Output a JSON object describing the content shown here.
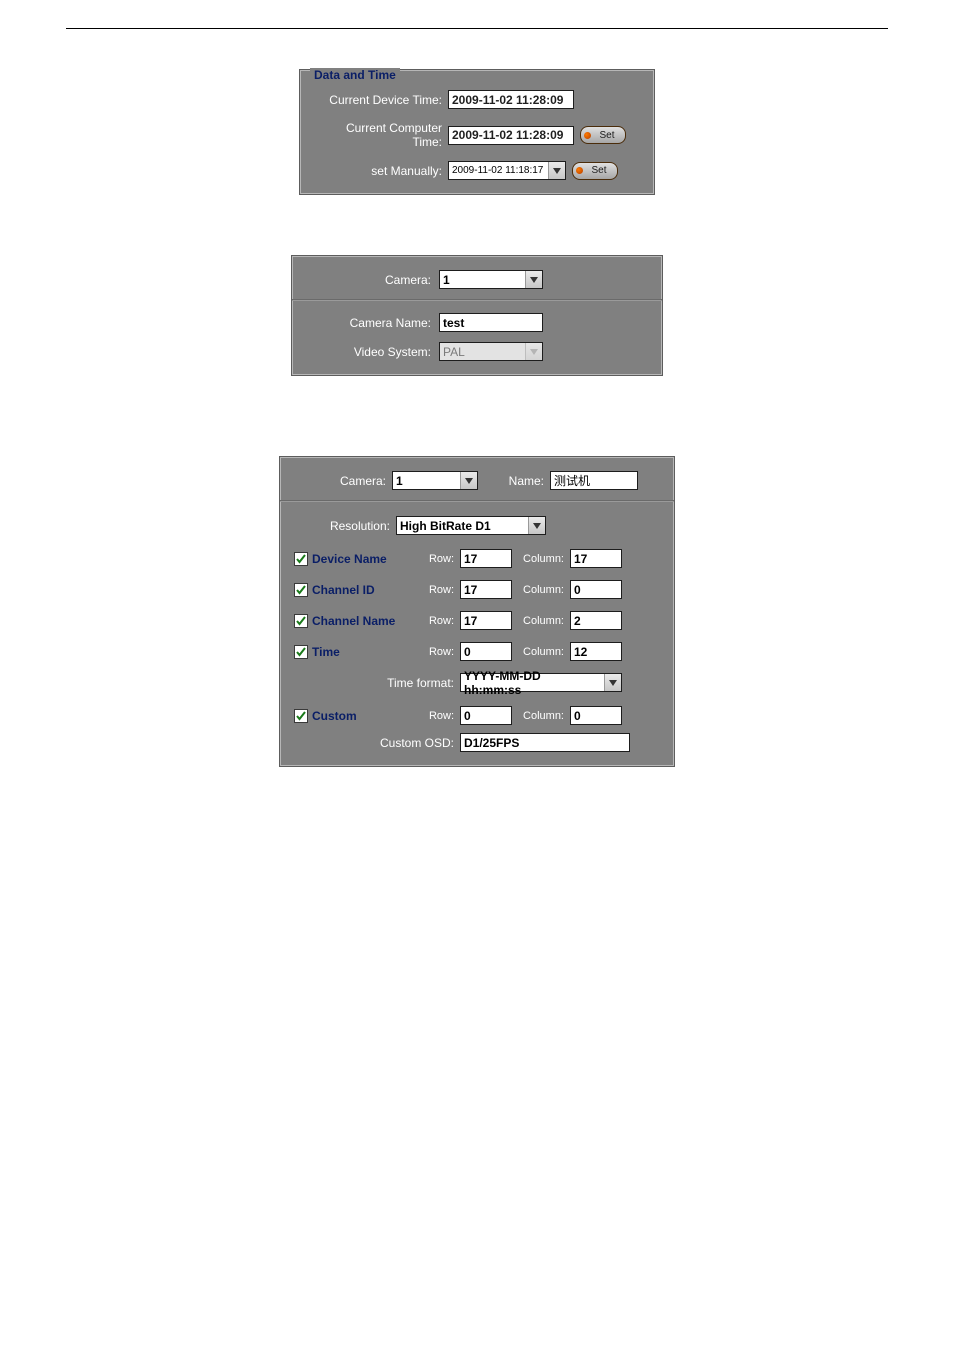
{
  "panel1": {
    "legend": "Data and Time",
    "current_device_time_label": "Current Device Time:",
    "current_device_time_value": "2009-11-02 11:28:09",
    "current_computer_time_label": "Current Computer Time:",
    "current_computer_time_value": "2009-11-02 11:28:09",
    "set_btn1": "Set",
    "set_manually_label": "set Manually:",
    "set_manually_value": "2009-11-02  11:18:17",
    "set_btn2": "Set"
  },
  "panel2": {
    "camera_label": "Camera:",
    "camera_value": "1",
    "camera_name_label": "Camera Name:",
    "camera_name_value": "test",
    "video_system_label": "Video System:",
    "video_system_value": "PAL"
  },
  "panel3": {
    "camera_label": "Camera:",
    "camera_value": "1",
    "name_label": "Name:",
    "name_value": "测试机",
    "resolution_label": "Resolution:",
    "resolution_value": "High BitRate D1",
    "row_label": "Row:",
    "column_label": "Column:",
    "device_name": {
      "label": "Device Name",
      "row": "17",
      "col": "17"
    },
    "channel_id": {
      "label": "Channel ID",
      "row": "17",
      "col": "0"
    },
    "channel_name": {
      "label": "Channel Name",
      "row": "17",
      "col": "2"
    },
    "time": {
      "label": "Time",
      "row": "0",
      "col": "12"
    },
    "time_format_label": "Time format:",
    "time_format_value": "YYYY-MM-DD hh:mm:ss",
    "custom": {
      "label": "Custom",
      "row": "0",
      "col": "0"
    },
    "custom_osd_label": "Custom OSD:",
    "custom_osd_value": "D1/25FPS"
  }
}
